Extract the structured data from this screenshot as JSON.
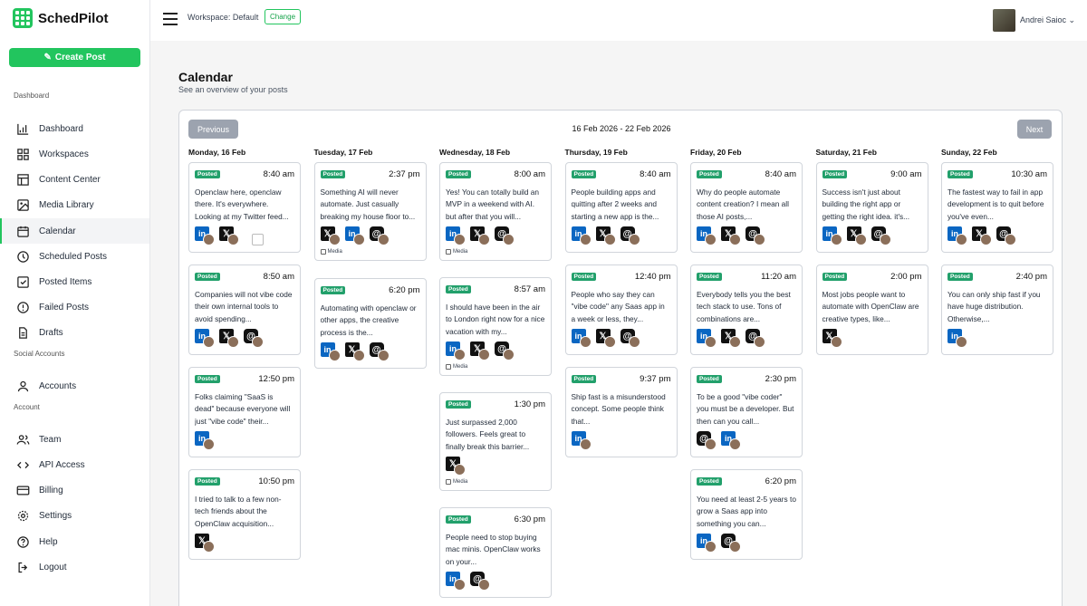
{
  "brand": {
    "name": "SchedPilot"
  },
  "sidebar": {
    "create_label": "Create Post",
    "sections": {
      "dashboard": "Dashboard",
      "social": "Social Accounts",
      "account": "Account"
    },
    "items": [
      {
        "label": "Dashboard",
        "icon": "dashboard-icon"
      },
      {
        "label": "Workspaces",
        "icon": "grid-icon"
      },
      {
        "label": "Content Center",
        "icon": "content-icon"
      },
      {
        "label": "Media Library",
        "icon": "image-icon"
      },
      {
        "label": "Calendar",
        "icon": "calendar-icon"
      },
      {
        "label": "Scheduled Posts",
        "icon": "clock-icon"
      },
      {
        "label": "Posted Items",
        "icon": "check-square-icon"
      },
      {
        "label": "Failed Posts",
        "icon": "alert-icon"
      },
      {
        "label": "Drafts",
        "icon": "file-icon"
      },
      {
        "label": "Accounts",
        "icon": "user-icon"
      },
      {
        "label": "Team",
        "icon": "team-icon"
      },
      {
        "label": "API Access",
        "icon": "api-icon"
      },
      {
        "label": "Billing",
        "icon": "card-icon"
      },
      {
        "label": "Settings",
        "icon": "gear-icon"
      },
      {
        "label": "Help",
        "icon": "help-icon"
      },
      {
        "label": "Logout",
        "icon": "logout-icon"
      }
    ]
  },
  "topbar": {
    "workspace": "Workspace: Default",
    "change": "Change",
    "user": "Andrei Saioc"
  },
  "page": {
    "title": "Calendar",
    "subtitle": "See an overview of your posts"
  },
  "calendar": {
    "prev": "Previous",
    "next": "Next",
    "range": "16 Feb 2026 - 22 Feb 2026",
    "status_label": "Posted",
    "media_label": "Media",
    "days": [
      {
        "label": "Monday, 16 Feb",
        "posts": [
          {
            "time": "8:40 am",
            "text": "Openclaw here, openclaw there. It's everywhere. Looking at my Twitter feed...",
            "platforms": [
              "li",
              "x",
              "img"
            ],
            "media": false
          },
          {
            "time": "8:50 am",
            "text": "Companies will not vibe code their own internal tools to avoid spending...",
            "platforms": [
              "li",
              "x",
              "th"
            ],
            "media": false
          },
          {
            "time": "12:50 pm",
            "text": "Folks claiming \"SaaS is dead\" because everyone will just \"vibe code\" their...",
            "platforms": [
              "li"
            ],
            "media": false
          },
          {
            "time": "10:50 pm",
            "text": "I tried to talk to a few non-tech friends about the OpenClaw acquisition...",
            "platforms": [
              "x"
            ],
            "media": false
          }
        ]
      },
      {
        "label": "Tuesday, 17 Feb",
        "posts": [
          {
            "time": "2:37 pm",
            "text": "Something AI will never automate. Just casually breaking my house floor to...",
            "platforms": [
              "x",
              "li",
              "th"
            ],
            "media": true
          },
          {
            "time": "6:20 pm",
            "text": "Automating with openclaw or other apps, the creative process is the...",
            "platforms": [
              "li",
              "x",
              "th"
            ],
            "media": false
          }
        ]
      },
      {
        "label": "Wednesday, 18 Feb",
        "posts": [
          {
            "time": "8:00 am",
            "text": "Yes! You can totally build an MVP in a weekend with AI. but after that you will...",
            "platforms": [
              "li",
              "x",
              "th"
            ],
            "media": true
          },
          {
            "time": "8:57 am",
            "text": "I should have been in the air to London right now for a nice vacation with my...",
            "platforms": [
              "li",
              "x",
              "th"
            ],
            "media": true
          },
          {
            "time": "1:30 pm",
            "text": "Just surpassed 2,000 followers. Feels great to finally break this barrier...",
            "platforms": [
              "x"
            ],
            "media": true
          },
          {
            "time": "6:30 pm",
            "text": "People need to stop buying mac minis. OpenClaw works on your...",
            "platforms": [
              "li",
              "th"
            ],
            "media": false
          }
        ]
      },
      {
        "label": "Thursday, 19 Feb",
        "posts": [
          {
            "time": "8:40 am",
            "text": "People building apps and quitting after 2 weeks and starting a new app is the...",
            "platforms": [
              "li",
              "x",
              "th"
            ],
            "media": false
          },
          {
            "time": "12:40 pm",
            "text": "People who say they can \"vibe code\" any Saas app in a week or less, they...",
            "platforms": [
              "li",
              "x",
              "th"
            ],
            "media": false
          },
          {
            "time": "9:37 pm",
            "text": "Ship fast is a misunderstood concept. Some people think that...",
            "platforms": [
              "li"
            ],
            "media": false
          }
        ]
      },
      {
        "label": "Friday, 20 Feb",
        "posts": [
          {
            "time": "8:40 am",
            "text": "Why do people automate content creation? I mean all those AI posts,...",
            "platforms": [
              "li",
              "x",
              "th"
            ],
            "media": false
          },
          {
            "time": "11:20 am",
            "text": "Everybody tells you the best tech stack to use. Tons of combinations are...",
            "platforms": [
              "li",
              "x",
              "th"
            ],
            "media": false
          },
          {
            "time": "2:30 pm",
            "text": "To be a good \"vibe coder\" you must be a developer. But then can you call...",
            "platforms": [
              "th",
              "li"
            ],
            "media": false
          },
          {
            "time": "6:20 pm",
            "text": "You need at least 2-5 years to grow a Saas app into something you can...",
            "platforms": [
              "li",
              "th"
            ],
            "media": false
          }
        ]
      },
      {
        "label": "Saturday, 21 Feb",
        "posts": [
          {
            "time": "9:00 am",
            "text": "Success isn't just about building the right app or getting the right idea. it's...",
            "platforms": [
              "li",
              "x",
              "th"
            ],
            "media": false
          },
          {
            "time": "2:00 pm",
            "text": "Most jobs people want to automate with OpenClaw are creative types, like...",
            "platforms": [
              "x"
            ],
            "media": false
          }
        ]
      },
      {
        "label": "Sunday, 22 Feb",
        "posts": [
          {
            "time": "10:30 am",
            "text": "The fastest way to fail in app development is to quit before you've even...",
            "platforms": [
              "li",
              "x",
              "th"
            ],
            "media": false
          },
          {
            "time": "2:40 pm",
            "text": "You can only ship fast if you have huge distribution. Otherwise,...",
            "platforms": [
              "li"
            ],
            "media": false
          }
        ]
      }
    ]
  },
  "colors": {
    "accent": "#22c55e",
    "posted": "#22a06b",
    "linkedin": "#0a66c2",
    "x": "#111111"
  }
}
